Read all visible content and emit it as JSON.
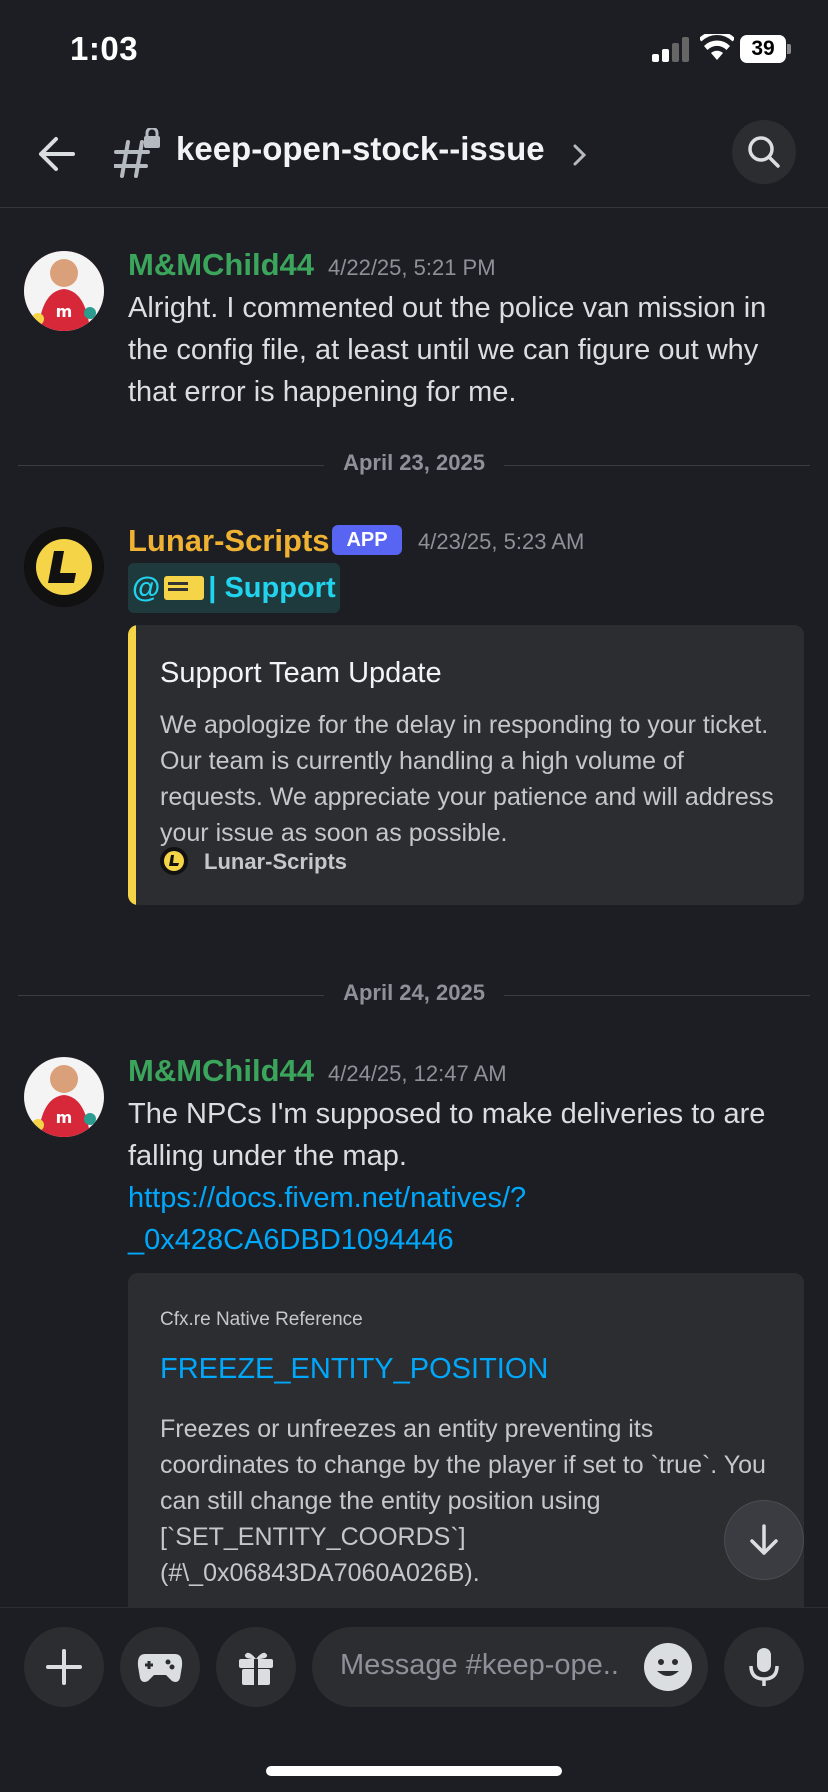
{
  "status": {
    "time": "1:03",
    "battery": "39"
  },
  "header": {
    "channel": "keep-open-stock--issue"
  },
  "messages": [
    {
      "username": "M&MChild44",
      "timestamp": "4/22/25, 5:21 PM",
      "text": "Alright. I commented out the police van mission in the config file, at least until we can figure out why that error is happening for me."
    }
  ],
  "dividers": [
    "April 23, 2025",
    "April 24, 2025"
  ],
  "bot_message": {
    "username": "Lunar-Scripts",
    "badge": "APP",
    "timestamp": "4/23/25, 5:23 AM",
    "mention_prefix": "@",
    "mention_suffix": "| Support",
    "embed": {
      "title": "Support Team Update",
      "description": "We apologize for the delay in responding to your ticket. Our team is currently handling a high volume of requests. We appreciate your patience and will address your issue as soon as possible.",
      "footer": "Lunar-Scripts"
    }
  },
  "message3": {
    "username": "M&MChild44",
    "timestamp": "4/24/25, 12:47 AM",
    "text": "The NPCs I'm supposed to make deliveries to are falling under the map.",
    "link": "https://docs.fivem.net/natives/?_0x428CA6DBD1094446",
    "link_line1": "https://docs.fivem.net/natives/?",
    "link_line2": "_0x428CA6DBD1094446",
    "embed": {
      "provider": "Cfx.re Native Reference",
      "title": "FREEZE_ENTITY_POSITION",
      "description": "Freezes or unfreezes an entity preventing its coordinates to change by the player if set to `true`. You can still change the entity position using [`SET_ENTITY_COORDS`](#\\_0x06843DA7060A026B)."
    }
  },
  "composer": {
    "placeholder": "Message #keep-ope.."
  },
  "colors": {
    "background": "#1d1e23",
    "username_green": "#3ba55c",
    "username_yellow": "#f0b232",
    "link": "#00a8fc",
    "embed_accent": "#f5d547",
    "app_badge": "#5865f2"
  }
}
